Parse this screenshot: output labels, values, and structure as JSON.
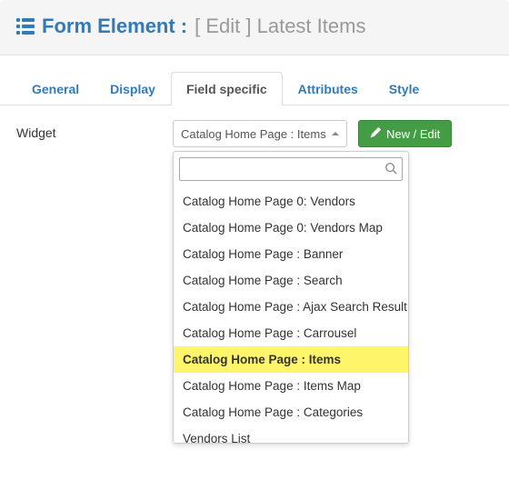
{
  "header": {
    "title_strong": "Form Element :",
    "title_muted": "[ Edit ] Latest Items"
  },
  "tabs": [
    {
      "label": "General",
      "active": false
    },
    {
      "label": "Display",
      "active": false
    },
    {
      "label": "Field specific",
      "active": true
    },
    {
      "label": "Attributes",
      "active": false
    },
    {
      "label": "Style",
      "active": false
    }
  ],
  "form": {
    "widget_label": "Widget",
    "select_value": "Catalog Home Page : Items",
    "new_edit_label": "New / Edit",
    "search_value": "",
    "options": [
      {
        "label": "Catalog Home Page 0: Vendors",
        "highlight": false
      },
      {
        "label": "Catalog Home Page 0: Vendors Map",
        "highlight": false
      },
      {
        "label": "Catalog Home Page : Banner",
        "highlight": false
      },
      {
        "label": "Catalog Home Page : Search",
        "highlight": false
      },
      {
        "label": "Catalog Home Page : Ajax Search Result",
        "highlight": false
      },
      {
        "label": "Catalog Home Page : Carrousel",
        "highlight": false
      },
      {
        "label": "Catalog Home Page : Items",
        "highlight": true
      },
      {
        "label": "Catalog Home Page : Items Map",
        "highlight": false
      },
      {
        "label": "Catalog Home Page : Categories",
        "highlight": false
      },
      {
        "label": "Vendors List",
        "highlight": false
      }
    ]
  }
}
